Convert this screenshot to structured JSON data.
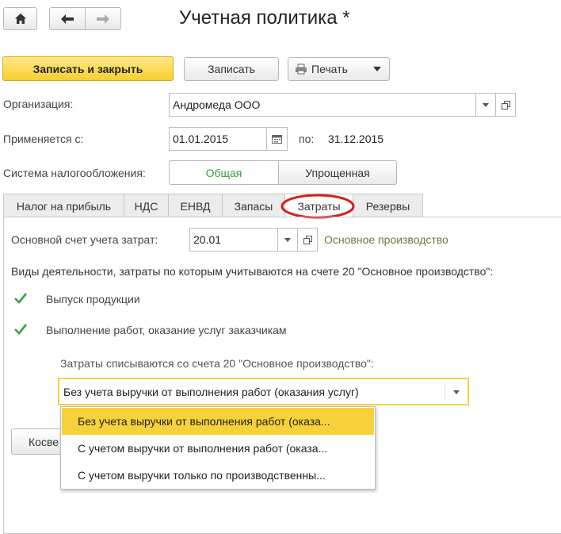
{
  "header": {
    "title": "Учетная политика *",
    "home_icon": "home-icon",
    "back_icon": "arrow-left-icon",
    "forward_icon": "arrow-right-icon"
  },
  "toolbar": {
    "save_close_label": "Записать и закрыть",
    "save_label": "Записать",
    "print_label": "Печать"
  },
  "form": {
    "organization_label": "Организация:",
    "organization_value": "Андромеда ООО",
    "applies_from_label": "Применяется с:",
    "applies_from_value": "01.01.2015",
    "applies_to_label": "по:",
    "applies_to_value": "31.12.2015",
    "tax_system_label": "Система налогообложения:",
    "tax_system_options": [
      "Общая",
      "Упрощенная"
    ],
    "tax_system_selected": "Общая"
  },
  "tabs": [
    {
      "label": "Налог на прибыль"
    },
    {
      "label": "НДС"
    },
    {
      "label": "ЕНВД"
    },
    {
      "label": "Запасы"
    },
    {
      "label": "Затраты"
    },
    {
      "label": "Резервы"
    }
  ],
  "active_tab": "Затраты",
  "costs": {
    "main_account_label": "Основной счет учета затрат:",
    "main_account_value": "20.01",
    "main_account_link": "Основное производство",
    "activities_caption": "Виды деятельности, затраты по которым учитываются на счете 20 \"Основное производство\":",
    "checkboxes": [
      {
        "label": "Выпуск продукции",
        "checked": true
      },
      {
        "label": "Выполнение работ, оказание услуг заказчикам",
        "checked": true
      }
    ],
    "writeoff_label": "Затраты списываются со счета 20 \"Основное производство\":",
    "writeoff_value": "Без учета выручки от выполнения работ (оказания услуг)",
    "writeoff_options": [
      "Без учета выручки от выполнения работ (оказа...",
      "С учетом выручки от выполнения работ (оказа...",
      "С учетом выручки только по производственны..."
    ],
    "indirect_button_label": "Косве"
  },
  "colors": {
    "accent_yellow": "#f6cf2d",
    "highlight_yellow": "#f7d13a",
    "green_text": "#3a9a3a",
    "link_olive": "#6b7a3a",
    "annotation_red": "#d81e1e"
  }
}
